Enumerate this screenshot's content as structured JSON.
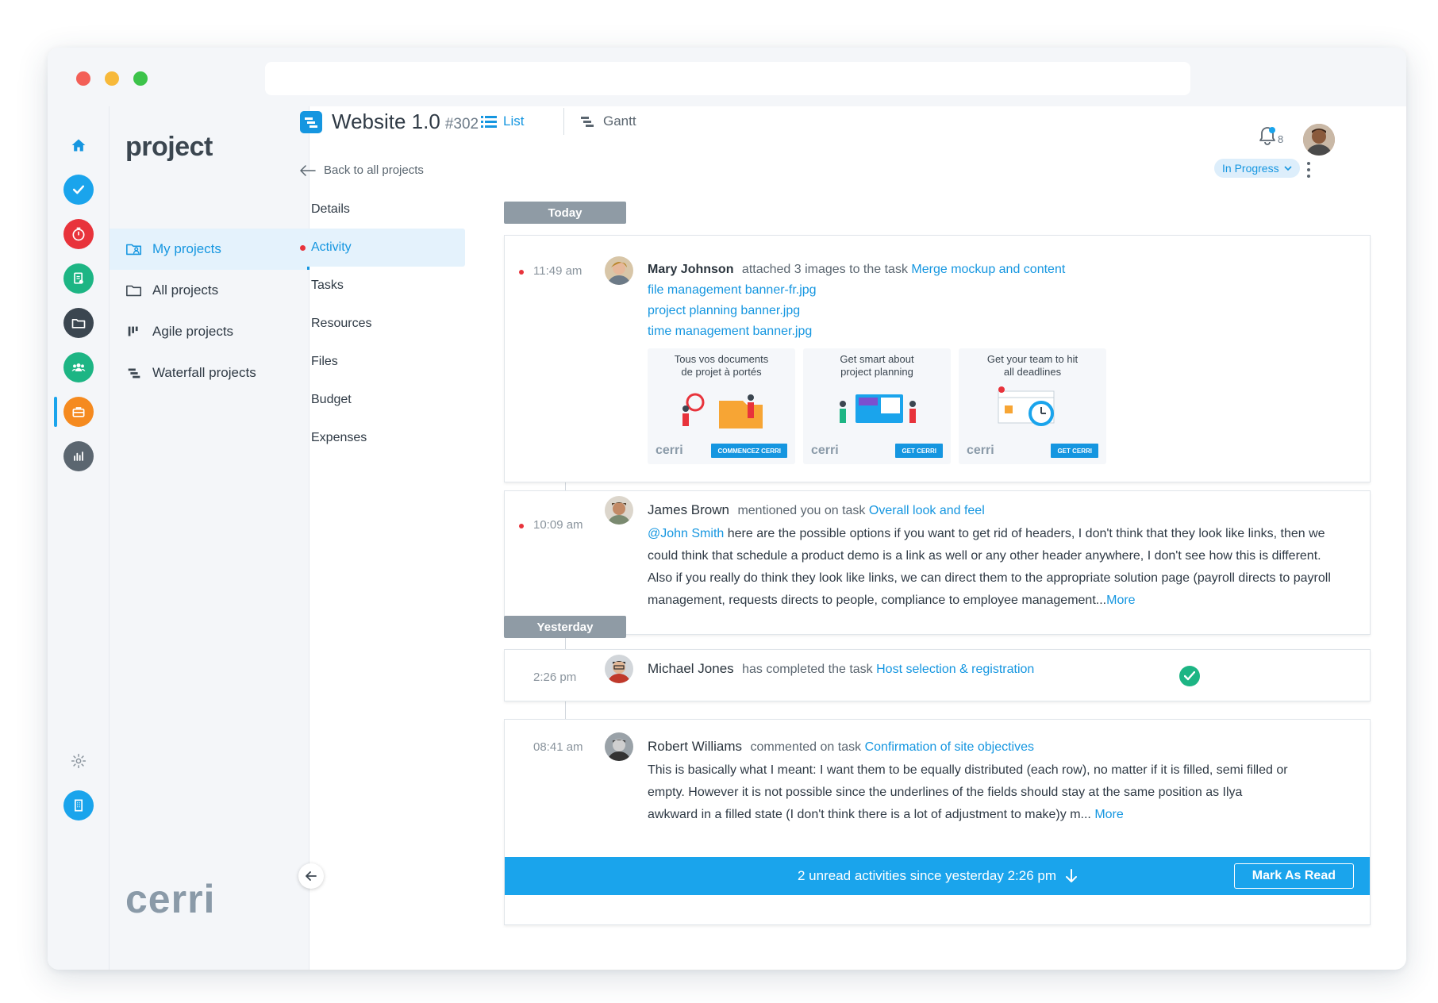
{
  "app": {
    "module_title": "project",
    "logo_text": "cerri"
  },
  "rail": {
    "items": [
      {
        "icon": "home-icon",
        "color": "#1596e0"
      },
      {
        "icon": "tasks-check-icon",
        "color": "#1aa4ec"
      },
      {
        "icon": "timer-icon",
        "color": "#e8333b"
      },
      {
        "icon": "document-icon",
        "color": "#1db584"
      },
      {
        "icon": "folder-icon",
        "color": "#3b4650"
      },
      {
        "icon": "team-icon",
        "color": "#1db584"
      },
      {
        "icon": "briefcase-icon",
        "color": "#f58a1f"
      },
      {
        "icon": "analytics-icon",
        "color": "#5b6670"
      }
    ],
    "settings_icon": "gear-icon",
    "company_icon": "building-icon"
  },
  "sidebar": {
    "items": [
      {
        "label": "My projects",
        "icon": "folder-user-icon",
        "active": true
      },
      {
        "label": "All projects",
        "icon": "folder-icon",
        "active": false
      },
      {
        "label": "Agile projects",
        "icon": "kanban-icon",
        "active": false
      },
      {
        "label": "Waterfall projects",
        "icon": "waterfall-icon",
        "active": false
      }
    ]
  },
  "header": {
    "project_name": "Website 1.0",
    "project_number": "#302",
    "view_list": "List",
    "view_gantt": "Gantt",
    "back_label": "Back to all projects",
    "notification_count": "8",
    "status": "In Progress",
    "accent": "#1596e0"
  },
  "subnav": {
    "items": [
      {
        "label": "Details",
        "active": false
      },
      {
        "label": "Activity",
        "active": true
      },
      {
        "label": "Tasks",
        "active": false
      },
      {
        "label": "Resources",
        "active": false
      },
      {
        "label": "Files",
        "active": false
      },
      {
        "label": "Budget",
        "active": false
      },
      {
        "label": "Expenses",
        "active": false
      }
    ]
  },
  "feed": {
    "today_label": "Today",
    "yesterday_label": "Yesterday",
    "entries": [
      {
        "time": "11:49 am",
        "unread": true,
        "user": "Mary Johnson",
        "action": "attached 3 images to the task",
        "target": "Merge mockup and content",
        "files": [
          "file management banner-fr.jpg",
          "project planning banner.jpg",
          "time management banner.jpg"
        ],
        "thumbnails": [
          {
            "caption_1": "Tous vos documents",
            "caption_2": "de projet à portés",
            "cta": "COMMENCEZ CERRI",
            "brand": "cerri"
          },
          {
            "caption_1": "Get smart about",
            "caption_2": "project planning",
            "cta": "GET CERRI",
            "brand": "cerri"
          },
          {
            "caption_1": "Get your team to hit",
            "caption_2": "all deadlines",
            "cta": "GET CERRI",
            "brand": "cerri"
          }
        ]
      },
      {
        "time": "10:09 am",
        "unread": true,
        "user": "James Brown",
        "action": "mentioned you on task",
        "target": "Overall look and feel",
        "mention": "@John Smith",
        "body": " here are the possible options if you want to get rid of headers, I don't think that they look like links, then we could think that schedule a product demo is a link as well or any other header anywhere, I don't see how this is different. Also if you really do think they look like links, we can direct them to the appropriate solution page (payroll directs to payroll management, requests directs to people, compliance to employee management...",
        "more": "More"
      },
      {
        "time": "2:26 pm",
        "unread": false,
        "user": "Michael Jones",
        "action": "has completed the task",
        "target": "Host selection & registration"
      },
      {
        "time": "08:41 am",
        "unread": false,
        "user": "Robert Williams",
        "action": "commented on task",
        "target": "Confirmation of site objectives",
        "body_1": "This is basically what I meant: I want them to be equally distributed (each row), no matter if it is filled, semi filled or",
        "body_2": "empty. However it is not possible since the underlines of the fields should stay at the same position as Ilya",
        "body_3": "awkward in a filled state (I don't think there is a lot of adjustment to make)y m...",
        "more": "More"
      }
    ]
  },
  "unread_bar": {
    "text": "2 unread activities since yesterday 2:26 pm",
    "button": "Mark As Read"
  }
}
